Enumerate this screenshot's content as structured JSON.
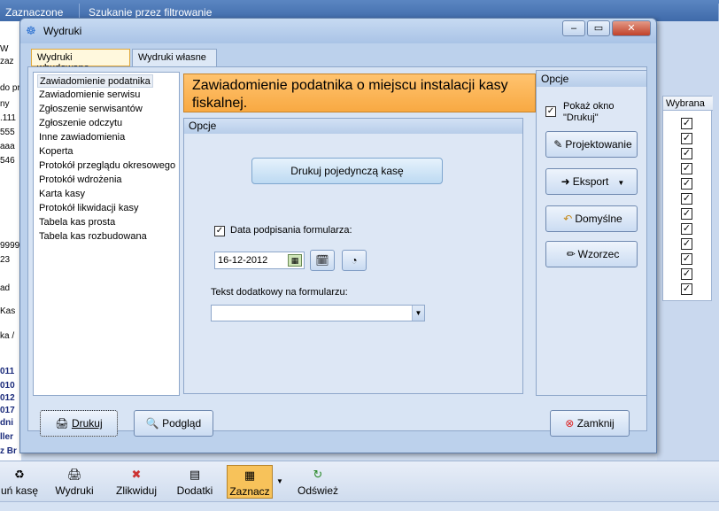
{
  "background": {
    "tabs": [
      "Zaznaczone",
      "Szukanie przez filtrowanie"
    ],
    "left_fragments": [
      "W",
      "zaz",
      "do pr",
      "ny",
      ".111",
      "555",
      "aaa",
      "546",
      "9999",
      "23",
      "ad",
      "Kas",
      "ka /",
      "011",
      "010",
      "012",
      "017",
      "dni",
      "ller",
      "z Br"
    ],
    "grid_header": "Wybrana",
    "grid_checks": [
      true,
      true,
      true,
      true,
      true,
      true,
      true,
      true,
      true,
      true,
      true,
      true
    ]
  },
  "toolbar": {
    "items": [
      {
        "label": "uń kasę",
        "icon": "♻"
      },
      {
        "label": "Wydruki",
        "icon": "🖨"
      },
      {
        "label": "Zlikwiduj",
        "icon": "✖"
      },
      {
        "label": "Dodatki",
        "icon": "▤"
      },
      {
        "label": "Zaznacz",
        "icon": "▦"
      },
      {
        "label": "Odśwież",
        "icon": "↻"
      }
    ]
  },
  "dialog": {
    "title": "Wydruki",
    "tabs": [
      "Wydruki wbudowane",
      "Wydruki własne"
    ],
    "list": [
      "Zawiadomienie podatnika",
      "Zawiadomienie serwisu",
      "Zgłoszenie serwisantów",
      "Zgłoszenie odczytu",
      "Inne zawiadomienia",
      "Koperta",
      "Protokół przeglądu okresowego",
      "Protokół wdrożenia",
      "Karta kasy",
      "Protokół likwidacji kasy",
      "Tabela kas prosta",
      "Tabela kas rozbudowana"
    ],
    "banner": "Zawiadomienie podatnika o miejscu instalacji kasy fiskalnej.",
    "options_title": "Opcje",
    "print_single": "Drukuj pojedynczą kasę",
    "date_checkbox_label": "Data podpisania formularza:",
    "date_value": "16-12-2012",
    "extra_text_label": "Tekst dodatkowy na formularzu:",
    "extra_text_value": "",
    "right_options_title": "Opcje",
    "show_print_label": "Pokaż okno \"Drukuj\"",
    "right_buttons": [
      "Projektowanie",
      "Eksport",
      "Domyślne",
      "Wzorzec"
    ],
    "print_button": "Drukuj",
    "preview_button": "Podgląd",
    "close_button": "Zamknij"
  }
}
